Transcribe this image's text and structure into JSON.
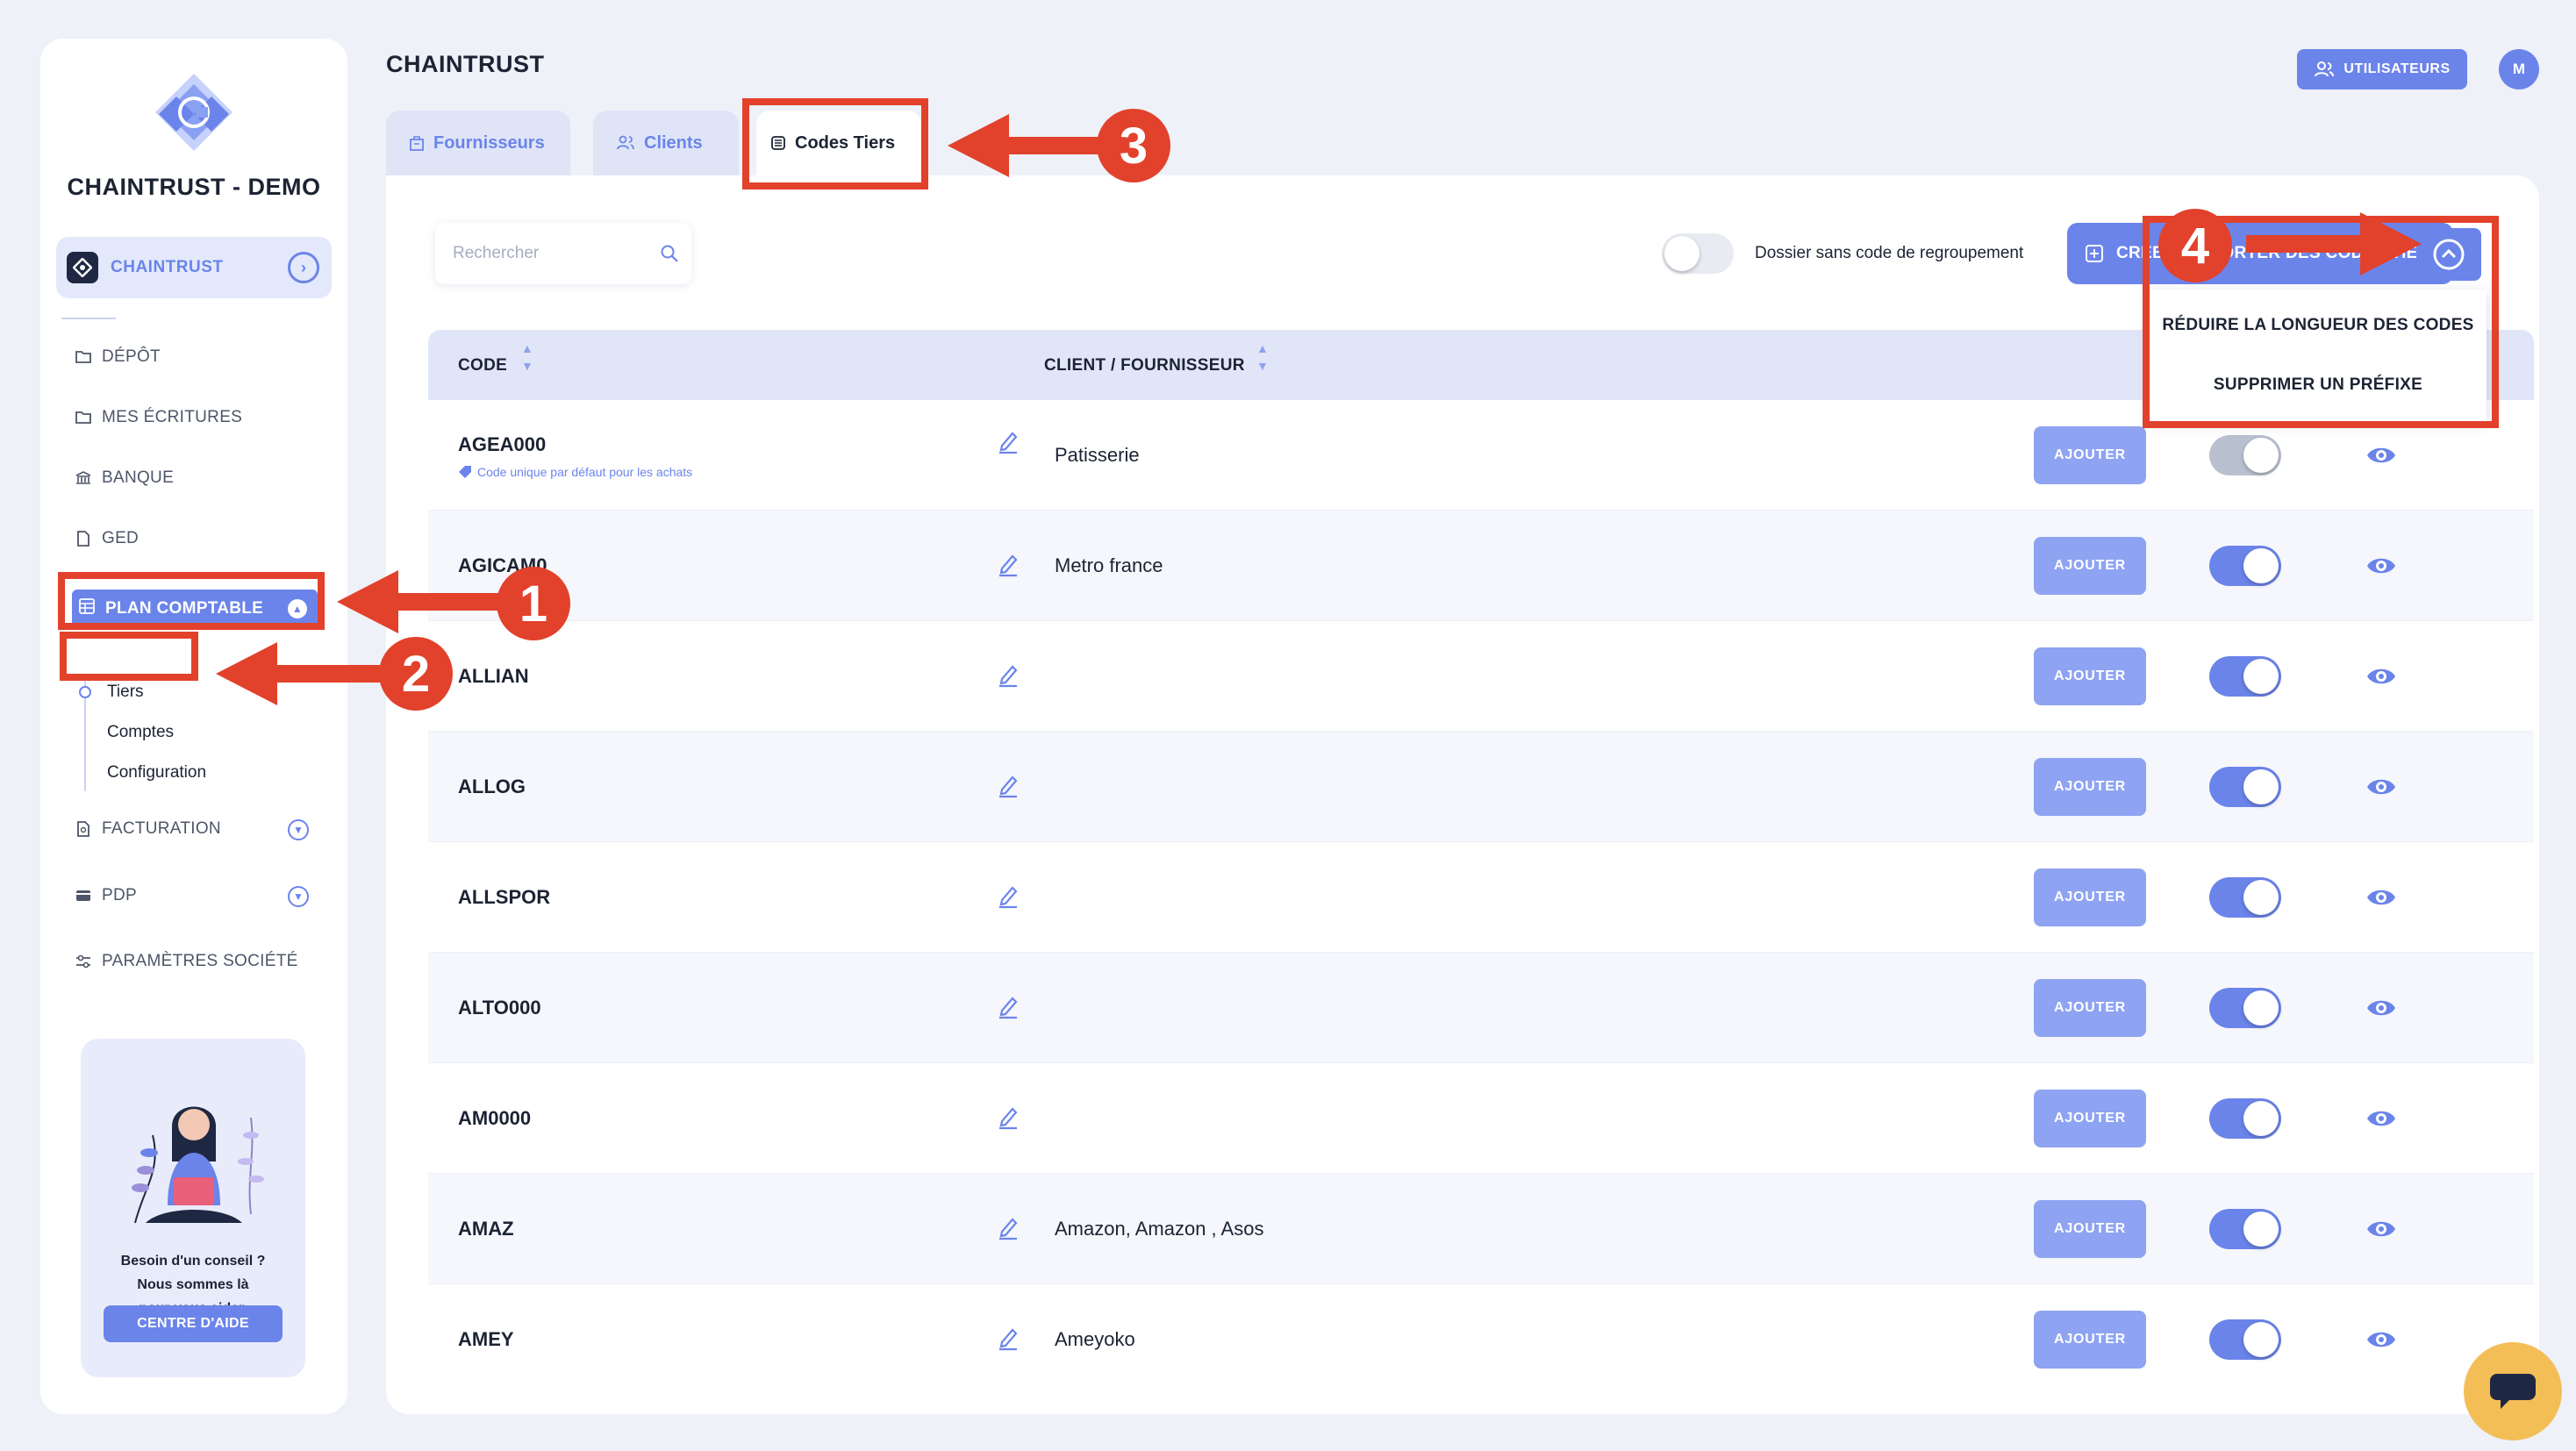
{
  "sidebar": {
    "brand": "CHAINTRUST - DEMO",
    "org_label": "CHAINTRUST",
    "nav": [
      {
        "label": "DÉPÔT",
        "icon": "folder-icon"
      },
      {
        "label": "MES ÉCRITURES",
        "icon": "folder-icon"
      },
      {
        "label": "BANQUE",
        "icon": "bank-icon"
      },
      {
        "label": "GED",
        "icon": "document-icon"
      }
    ],
    "active_label": "PLAN COMPTABLE",
    "sub_items": [
      "Tiers",
      "Comptes",
      "Configuration"
    ],
    "nav_bottom": [
      {
        "label": "FACTURATION",
        "icon": "invoice-icon"
      },
      {
        "label": "PDP",
        "icon": "card-icon"
      },
      {
        "label": "PARAMÈTRES SOCIÉTÉ",
        "icon": "sliders-icon"
      }
    ],
    "help": {
      "line1": "Besoin d'un conseil ?",
      "line2": "Nous sommes là",
      "line3": "pour vous aider.",
      "button": "CENTRE D'AIDE"
    }
  },
  "header": {
    "title": "CHAINTRUST",
    "users_button": "UTILISATEURS",
    "avatar": "M"
  },
  "tabs": [
    "Fournisseurs",
    "Clients",
    "Codes Tiers"
  ],
  "toolbar": {
    "search_placeholder": "Rechercher",
    "toggle_label": "Dossier sans code de regroupement",
    "create_button": "CRÉER / IMPORTER DES CODES TIERS"
  },
  "dropdown": [
    "RÉDUIRE LA LONGUEUR DES CODES",
    "SUPPRIMER UN PRÉFIXE"
  ],
  "table": {
    "headers": [
      "CODE",
      "CLIENT / FOURNISSEUR"
    ],
    "add_label": "AJOUTER",
    "default_note": "Code unique par défaut pour les achats",
    "rows": [
      {
        "code": "AGEA000",
        "client": "Patisserie",
        "active": false
      },
      {
        "code": "AGICAM0",
        "client": "Metro france",
        "active": true
      },
      {
        "code": "ALLIAN",
        "client": "",
        "active": true
      },
      {
        "code": "ALLOG",
        "client": "",
        "active": true
      },
      {
        "code": "ALLSPOR",
        "client": "",
        "active": true
      },
      {
        "code": "ALTO000",
        "client": "",
        "active": true
      },
      {
        "code": "AM0000",
        "client": "",
        "active": true
      },
      {
        "code": "AMAZ",
        "client": "Amazon, Amazon , Asos",
        "active": true
      },
      {
        "code": "AMEY",
        "client": "Ameyoko",
        "active": true
      }
    ]
  },
  "annotations": [
    "1",
    "2",
    "3",
    "4"
  ],
  "colors": {
    "accent": "#6b84ea",
    "annotation": "#e2412b",
    "chat": "#f4be57"
  }
}
